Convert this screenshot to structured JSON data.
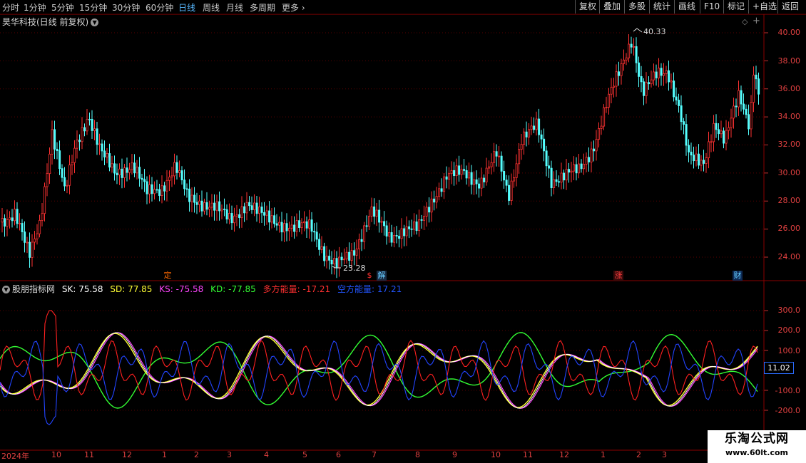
{
  "toolbar": {
    "periods": [
      "分时",
      "1分钟",
      "5分钟",
      "15分钟",
      "30分钟",
      "60分钟",
      "日线",
      "周线",
      "月线",
      "多周期",
      "更多"
    ],
    "active_period": "日线",
    "tools": [
      "复权",
      "叠加",
      "多股",
      "统计",
      "画线",
      "F10",
      "标记",
      "+自选",
      "返回"
    ]
  },
  "stock": {
    "title": "昊华科技(日线 前复权)"
  },
  "price_axis": [
    "40.00",
    "38.00",
    "36.00",
    "34.00",
    "32.00",
    "30.00",
    "28.00",
    "26.00",
    "24.00"
  ],
  "price_annotations": {
    "high": "40.33",
    "low": "23.28"
  },
  "event_markers": [
    {
      "label": "定",
      "color": "#ff6a00",
      "bg": "#000"
    },
    {
      "label": "$",
      "color": "#ff3030",
      "bg": "#000"
    },
    {
      "label": "解",
      "color": "#66ccff",
      "bg": "#1a2c44"
    },
    {
      "label": "涨",
      "color": "#ff4040",
      "bg": "#3a0a0a"
    },
    {
      "label": "财",
      "color": "#66ccff",
      "bg": "#0d2a55"
    }
  ],
  "indicator": {
    "name": "股朋指标网",
    "sk": {
      "label": "SK: 75.58",
      "color": "#ffffff"
    },
    "sd": {
      "label": "SD: 77.85",
      "color": "#ffff33"
    },
    "ks": {
      "label": "KS: -75.58",
      "color": "#ff44ff"
    },
    "kd": {
      "label": "KD: -77.85",
      "color": "#33ff33"
    },
    "long_energy": {
      "label": "多方能量: -17.21",
      "color": "#ff3030"
    },
    "short_energy": {
      "label": "空方能量: 17.21",
      "color": "#2255ff"
    },
    "axis": [
      "300.0",
      "200.0",
      "100.0",
      "-100.0",
      "-200.0"
    ],
    "current_value": "11.02"
  },
  "date_axis": [
    "2024年",
    "10",
    "11",
    "12",
    "1",
    "2",
    "3",
    "4",
    "5",
    "6",
    "7",
    "8",
    "9",
    "10",
    "11",
    "12",
    "1",
    "2",
    "3"
  ],
  "watermark": {
    "line1": "乐淘公式网",
    "line2": "www.60lt.com"
  },
  "colors": {
    "up": "#ff3232",
    "down": "#54ffff",
    "grid": "#5a0000",
    "axis": "#e04040"
  }
}
